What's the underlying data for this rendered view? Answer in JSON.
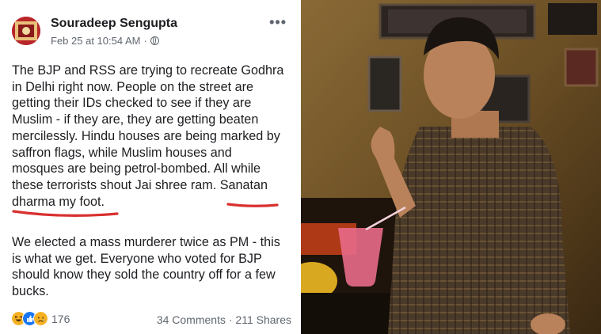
{
  "post": {
    "author": "Souradeep Sengupta",
    "timestamp": "Feb 25 at 10:54 AM",
    "separator": "·",
    "more_icon": "more-options-icon",
    "paragraph1_lines": [
      "The BJP and RSS are trying to recreate Godhra",
      "in Delhi right now. People on the street are",
      "getting their IDs checked to see if they are",
      "Muslim - if they are, they are getting beaten",
      "mercilessly. Hindu houses are being marked by",
      "saffron flags, while Muslim houses and",
      "mosques are being petrol-bombed. All while",
      "these terrorists shout Jai shree ram. Sanatan",
      "dharma my foot."
    ],
    "paragraph2_lines": [
      "We elected a mass murderer twice as PM - this",
      "is what we get. Everyone who voted for BJP",
      "should know they sold the country off for a few",
      "bucks."
    ],
    "reactions": [
      "haha",
      "like",
      "sad"
    ],
    "reaction_count": "176",
    "comments": "34 Comments",
    "shares": "211 Shares",
    "stats_separator": "·"
  },
  "colors": {
    "annotation_red": "#d8302f",
    "text": "#1c1e21",
    "secondary_text": "#606770",
    "like_blue": "#1877f2"
  }
}
